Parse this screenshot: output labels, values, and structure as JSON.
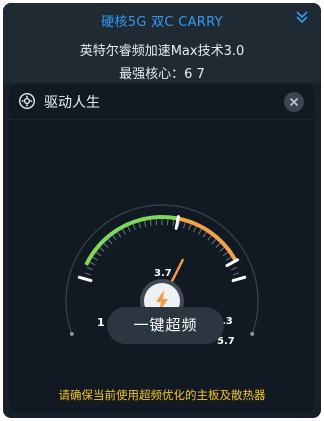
{
  "header": {
    "title": "硬核5G 双C CARRY",
    "subtitle": "英特尔睿频加速Max技术3.0",
    "cores": "最强核心：6  7"
  },
  "card": {
    "title": "驱动人生",
    "boost_button": "一键超频",
    "warning": "请确保当前使用超频优化的主板及散热器"
  },
  "gauge": {
    "unit_labels": [
      "1",
      "3.7",
      "5.3",
      "5.7"
    ],
    "min": 1,
    "max": 5.7,
    "base": 3.7,
    "turbo": 5.3,
    "current": 4.2,
    "colors": {
      "low": "#7ed85a",
      "high": "#f4a24a",
      "needle": "#f79a3e",
      "bolt": "#f79a3e"
    }
  },
  "icons": {
    "settings": "gear-icon",
    "close": "close-icon",
    "collapse": "chevron-double-down-icon",
    "bolt": "lightning-icon"
  }
}
